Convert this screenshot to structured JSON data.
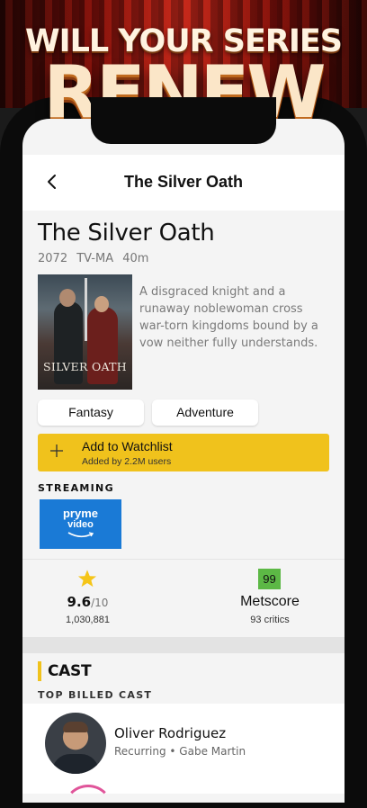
{
  "promo": {
    "line1": "WILL YOUR SERIES",
    "line2": "RENEW"
  },
  "nav": {
    "title": "The Silver Oath",
    "back_icon": "chevron-left-icon"
  },
  "show": {
    "title": "The Silver Oath",
    "year": "2072",
    "rating": "TV-MA",
    "runtime": "40m",
    "poster_title": "SILVER OATH",
    "synopsis": "A disgraced knight and a runaway noblewoman cross war-torn kingdoms bound by a vow neither fully understands."
  },
  "genres": [
    "Fantasy",
    "Adventure"
  ],
  "watchlist": {
    "label": "Add to Watchlist",
    "sub": "Added by 2.2M users",
    "icon": "plus-icon",
    "color": "#f0c21c"
  },
  "streaming": {
    "label": "STREAMING",
    "provider_line1": "pryme",
    "provider_line2": "video",
    "provider_color": "#1a7ad6"
  },
  "ratings": {
    "star_icon": "star-icon",
    "score": "9.6",
    "out_of": "/10",
    "count": "1,030,881",
    "metscore_value": "99",
    "metscore_label": "Metscore",
    "critics": "93 critics",
    "metscore_color": "#5cb845"
  },
  "cast": {
    "heading": "CAST",
    "subheading": "TOP BILLED CAST",
    "members": [
      {
        "name": "Oliver Rodriguez",
        "role": "Recurring • Gabe Martin"
      }
    ]
  }
}
